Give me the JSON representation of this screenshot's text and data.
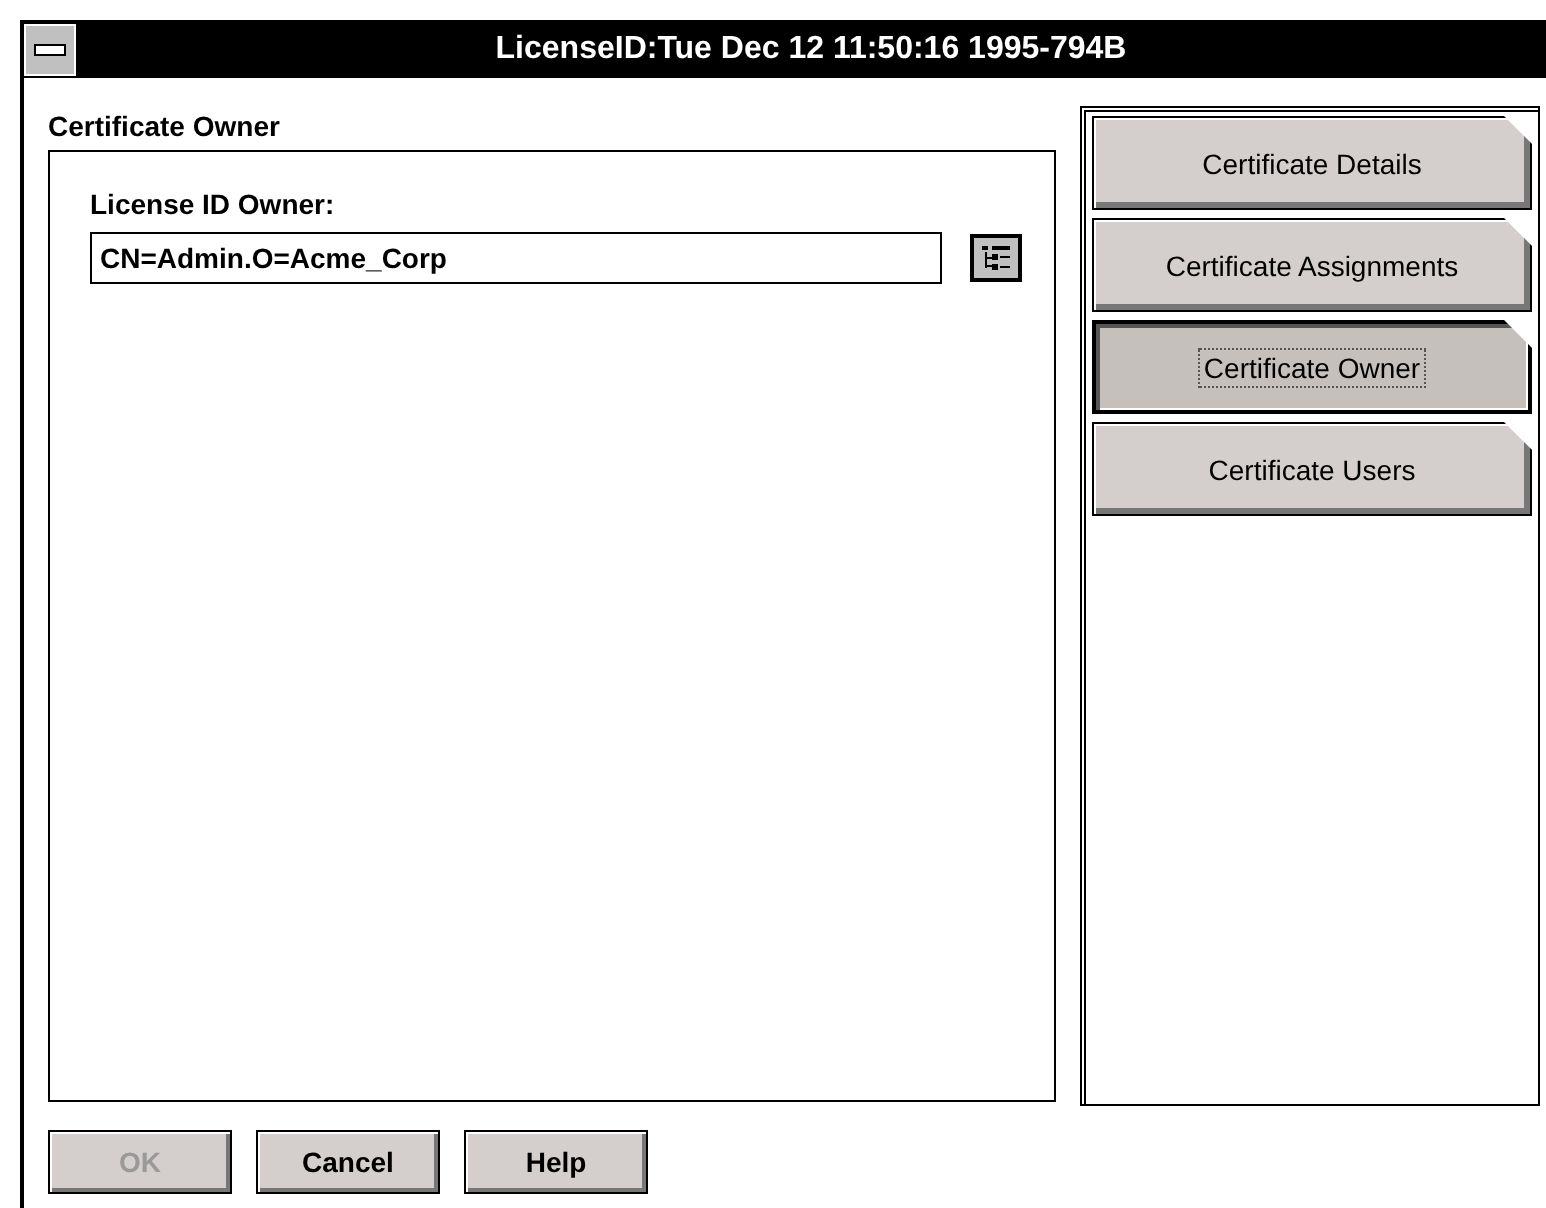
{
  "window": {
    "title": "LicenseID:Tue Dec 12 11:50:16 1995-794B"
  },
  "section": {
    "title": "Certificate Owner"
  },
  "owner_field": {
    "label": "License ID Owner:",
    "value": "CN=Admin.O=Acme_Corp"
  },
  "pages": [
    {
      "label": "Certificate Details",
      "selected": false
    },
    {
      "label": "Certificate Assignments",
      "selected": false
    },
    {
      "label": "Certificate Owner",
      "selected": true
    },
    {
      "label": "Certificate Users",
      "selected": false
    }
  ],
  "buttons": [
    {
      "label": "OK",
      "disabled": true
    },
    {
      "label": "Cancel",
      "disabled": false
    },
    {
      "label": "Help",
      "disabled": false
    }
  ]
}
